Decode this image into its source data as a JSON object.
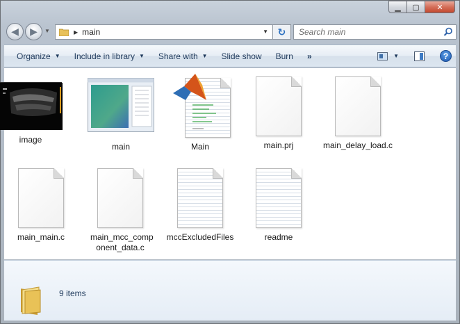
{
  "window": {
    "caption_min": "▁",
    "caption_max": "▢",
    "caption_close": "✕"
  },
  "address": {
    "path": "main",
    "search_placeholder": "Search main"
  },
  "toolbar": {
    "organize": "Organize",
    "include_in_library": "Include in library",
    "share_with": "Share with",
    "slide_show": "Slide show",
    "burn": "Burn",
    "more": "»",
    "help": "?"
  },
  "files": [
    {
      "name": "image",
      "kind": "image-thumbnail"
    },
    {
      "name": "main",
      "kind": "figure-thumbnail"
    },
    {
      "name": "Main",
      "kind": "matlab-script"
    },
    {
      "name": "main.prj",
      "kind": "blank-doc"
    },
    {
      "name": "main_delay_load.c",
      "kind": "blank-doc"
    },
    {
      "name": "main_main.c",
      "kind": "blank-doc"
    },
    {
      "name": "main_mcc_comp onent_data.c",
      "kind": "blank-doc"
    },
    {
      "name": "mccExcludedFiles",
      "kind": "text-doc"
    },
    {
      "name": "readme",
      "kind": "text-doc"
    }
  ],
  "status": {
    "item_count": "9 items"
  },
  "colors": {
    "accent": "#1e395b",
    "window_chrome": "#b9c3cf",
    "folder": "#e8c15a"
  }
}
